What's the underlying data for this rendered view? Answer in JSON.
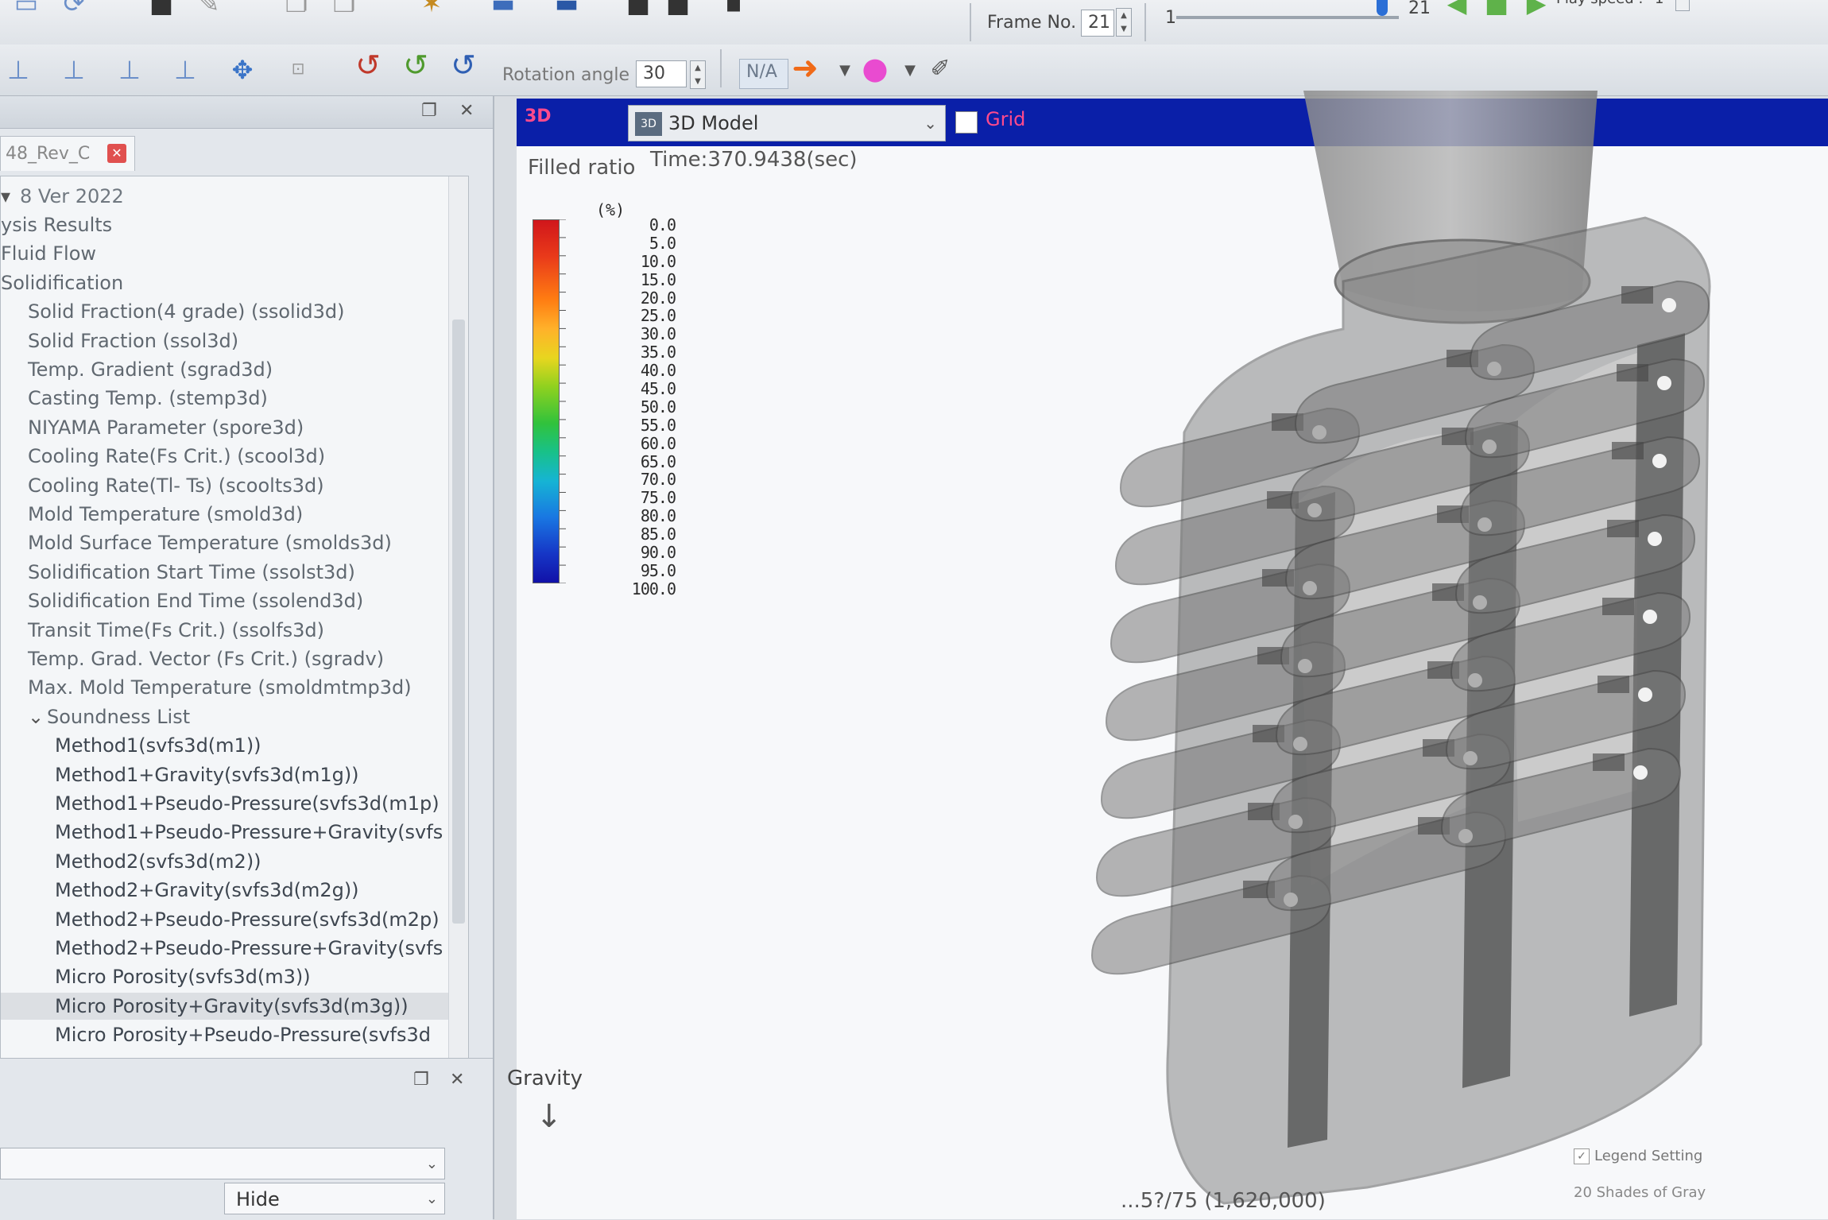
{
  "toolbar": {
    "rotation_angle_label": "Rotation angle :",
    "rotation_angle_value": "30",
    "na_label": "N/A",
    "frame_no_label": "Frame No. :",
    "frame_no_value": "21",
    "slider_start": "1",
    "slider_value": "21",
    "play_speed_label": "Play speed :",
    "play_speed_value": "1"
  },
  "left_panel": {
    "tab_label": "48_Rev_C",
    "version_label": "8 Ver 2022",
    "tree_items": [
      {
        "label": "ysis Results",
        "indent": 0
      },
      {
        "label": "Fluid Flow",
        "indent": 0
      },
      {
        "label": "Solidification",
        "indent": 0
      },
      {
        "label": "Solid Fraction(4 grade) (ssolid3d)",
        "indent": 1
      },
      {
        "label": "Solid Fraction (ssol3d)",
        "indent": 1
      },
      {
        "label": "Temp. Gradient (sgrad3d)",
        "indent": 1
      },
      {
        "label": "Casting Temp. (stemp3d)",
        "indent": 1
      },
      {
        "label": "NIYAMA Parameter (spore3d)",
        "indent": 1
      },
      {
        "label": "Cooling Rate(Fs Crit.) (scool3d)",
        "indent": 1
      },
      {
        "label": "Cooling Rate(Tl- Ts) (scoolts3d)",
        "indent": 1
      },
      {
        "label": "Mold Temperature (smold3d)",
        "indent": 1
      },
      {
        "label": "Mold Surface Temperature (smolds3d)",
        "indent": 1
      },
      {
        "label": "Solidification Start Time (ssolst3d)",
        "indent": 1
      },
      {
        "label": "Solidification End Time (ssolend3d)",
        "indent": 1
      },
      {
        "label": "Transit Time(Fs Crit.) (ssolfs3d)",
        "indent": 1
      },
      {
        "label": "Temp. Grad. Vector (Fs Crit.) (sgradv)",
        "indent": 1
      },
      {
        "label": "Max. Mold Temperature (smoldmtmp3d)",
        "indent": 1
      },
      {
        "label": "Soundness List",
        "indent": 1
      },
      {
        "label": "Method1(svfs3d(m1))",
        "indent": 2
      },
      {
        "label": "Method1+Gravity(svfs3d(m1g))",
        "indent": 2
      },
      {
        "label": "Method1+Pseudo-Pressure(svfs3d(m1p)",
        "indent": 2
      },
      {
        "label": "Method1+Pseudo-Pressure+Gravity(svfs",
        "indent": 2
      },
      {
        "label": "Method2(svfs3d(m2))",
        "indent": 2
      },
      {
        "label": "Method2+Gravity(svfs3d(m2g))",
        "indent": 2
      },
      {
        "label": "Method2+Pseudo-Pressure(svfs3d(m2p)",
        "indent": 2
      },
      {
        "label": "Method2+Pseudo-Pressure+Gravity(svfs",
        "indent": 2
      },
      {
        "label": "Micro Porosity(svfs3d(m3))",
        "indent": 2
      },
      {
        "label": "Micro Porosity+Gravity(svfs3d(m3g))",
        "indent": 2
      },
      {
        "label": "Micro Porosity+Pseudo-Pressure(svfs3d",
        "indent": 2
      }
    ],
    "hide_label": "Hide"
  },
  "viewport": {
    "tag": "3D",
    "view_mode": "3D Model",
    "grid_label": "Grid",
    "result_label": "Filled ratio",
    "time_label": "Time:370.9438(sec)",
    "legend_unit": "(%)",
    "legend_values": [
      "0.0",
      "5.0",
      "10.0",
      "15.0",
      "20.0",
      "25.0",
      "30.0",
      "35.0",
      "40.0",
      "45.0",
      "50.0",
      "55.0",
      "60.0",
      "65.0",
      "70.0",
      "75.0",
      "80.0",
      "85.0",
      "90.0",
      "95.0",
      "100.0"
    ],
    "gravity_label": "Gravity",
    "status_text": "...5?/75 (1,620,000)",
    "legend_setting_label": "Legend Setting",
    "shades_label": "20 Shades of Gray"
  },
  "colors": {
    "viewport_header": "#0a1fa8",
    "accent_pink": "#ff4a8c",
    "legend_top": "#d0161b",
    "legend_bottom": "#1111a8"
  },
  "icons": [
    "axis-icon",
    "rotate-x-icon",
    "rotate-y-icon",
    "rotate-z-icon",
    "play-arrow-icon",
    "color-ball-icon",
    "pick-tool-icon"
  ]
}
